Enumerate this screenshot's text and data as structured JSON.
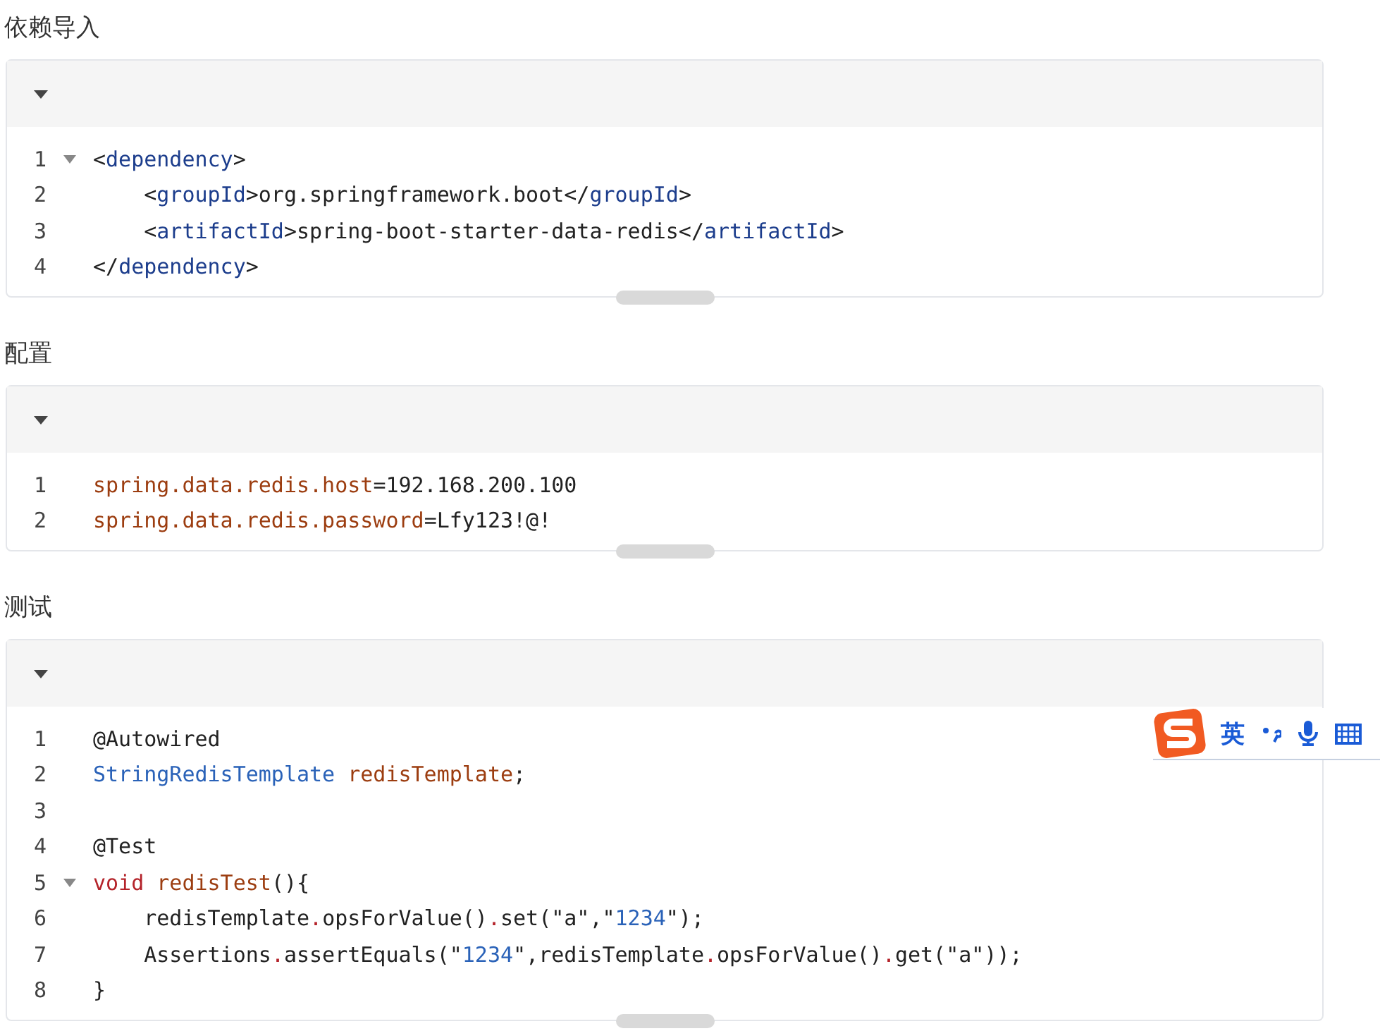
{
  "sections": [
    {
      "heading": "依赖导入",
      "lines": [
        {
          "number": "1",
          "fold": true,
          "tokens": [
            {
              "t": "<",
              "kind": "plain"
            },
            {
              "t": "dependency",
              "kind": "tag"
            },
            {
              "t": ">",
              "kind": "plain"
            }
          ]
        },
        {
          "number": "2",
          "fold": false,
          "tokens": [
            {
              "t": "    <",
              "kind": "plain"
            },
            {
              "t": "groupId",
              "kind": "tag"
            },
            {
              "t": ">org.springframework.boot</",
              "kind": "plain"
            },
            {
              "t": "groupId",
              "kind": "tag"
            },
            {
              "t": ">",
              "kind": "plain"
            }
          ]
        },
        {
          "number": "3",
          "fold": false,
          "tokens": [
            {
              "t": "    <",
              "kind": "plain"
            },
            {
              "t": "artifactId",
              "kind": "tag"
            },
            {
              "t": ">spring-boot-starter-data-redis</",
              "kind": "plain"
            },
            {
              "t": "artifactId",
              "kind": "tag"
            },
            {
              "t": ">",
              "kind": "plain"
            }
          ]
        },
        {
          "number": "4",
          "fold": false,
          "tokens": [
            {
              "t": "</",
              "kind": "plain"
            },
            {
              "t": "dependency",
              "kind": "tag"
            },
            {
              "t": ">",
              "kind": "plain"
            }
          ]
        }
      ]
    },
    {
      "heading": "配置",
      "lines": [
        {
          "number": "1",
          "fold": false,
          "tokens": [
            {
              "t": "spring.data.redis.host",
              "kind": "prop"
            },
            {
              "t": "=192.168.200.100",
              "kind": "plain"
            }
          ]
        },
        {
          "number": "2",
          "fold": false,
          "tokens": [
            {
              "t": "spring.data.redis.password",
              "kind": "prop"
            },
            {
              "t": "=Lfy123!@!",
              "kind": "plain"
            }
          ]
        }
      ]
    },
    {
      "heading": "测试",
      "lines": [
        {
          "number": "1",
          "fold": false,
          "tokens": [
            {
              "t": "@Autowired",
              "kind": "plain"
            }
          ]
        },
        {
          "number": "2",
          "fold": false,
          "tokens": [
            {
              "t": "StringRedisTemplate",
              "kind": "type"
            },
            {
              "t": " redisTemplate",
              "kind": "prop"
            },
            {
              "t": ";",
              "kind": "plain"
            }
          ]
        },
        {
          "number": "3",
          "fold": false
        },
        {
          "number": "4",
          "fold": false,
          "tokens": [
            {
              "t": "@Test",
              "kind": "plain"
            }
          ]
        },
        {
          "number": "5",
          "fold": true,
          "tokens": [
            {
              "t": "void",
              "kind": "keyword"
            },
            {
              "t": " redisTest",
              "kind": "prop"
            },
            {
              "t": "(){",
              "kind": "plain"
            }
          ]
        },
        {
          "number": "6",
          "fold": false,
          "tokens": [
            {
              "t": "    redisTemplate",
              "kind": "plain"
            },
            {
              "t": ".",
              "kind": "keyword"
            },
            {
              "t": "opsForValue()",
              "kind": "plain"
            },
            {
              "t": ".",
              "kind": "keyword"
            },
            {
              "t": "set(\"a\",\"",
              "kind": "plain"
            },
            {
              "t": "1234",
              "kind": "num"
            },
            {
              "t": "\");",
              "kind": "plain"
            }
          ]
        },
        {
          "number": "7",
          "fold": false,
          "tokens": [
            {
              "t": "    Assertions",
              "kind": "plain"
            },
            {
              "t": ".",
              "kind": "keyword"
            },
            {
              "t": "assertEquals(\"",
              "kind": "plain"
            },
            {
              "t": "1234",
              "kind": "num"
            },
            {
              "t": "\",redisTemplate",
              "kind": "plain"
            },
            {
              "t": ".",
              "kind": "keyword"
            },
            {
              "t": "opsForValue()",
              "kind": "plain"
            },
            {
              "t": ".",
              "kind": "keyword"
            },
            {
              "t": "get(\"a\"));",
              "kind": "plain"
            }
          ]
        },
        {
          "number": "8",
          "fold": false,
          "tokens": [
            {
              "t": "}",
              "kind": "plain"
            }
          ]
        }
      ]
    }
  ],
  "ime_toolbar": {
    "mode": "英"
  }
}
